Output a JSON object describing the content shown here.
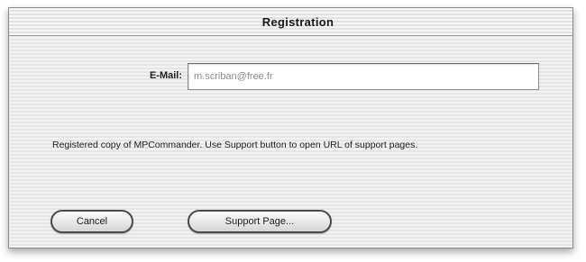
{
  "window": {
    "title": "Registration"
  },
  "email": {
    "label": "E-Mail:",
    "value": "m.scriban@free.fr",
    "placeholder": ""
  },
  "message": "Registered copy of MPCommander. Use Support button to open URL of support pages.",
  "buttons": {
    "cancel_label": "Cancel",
    "support_label": "Support Page..."
  }
}
